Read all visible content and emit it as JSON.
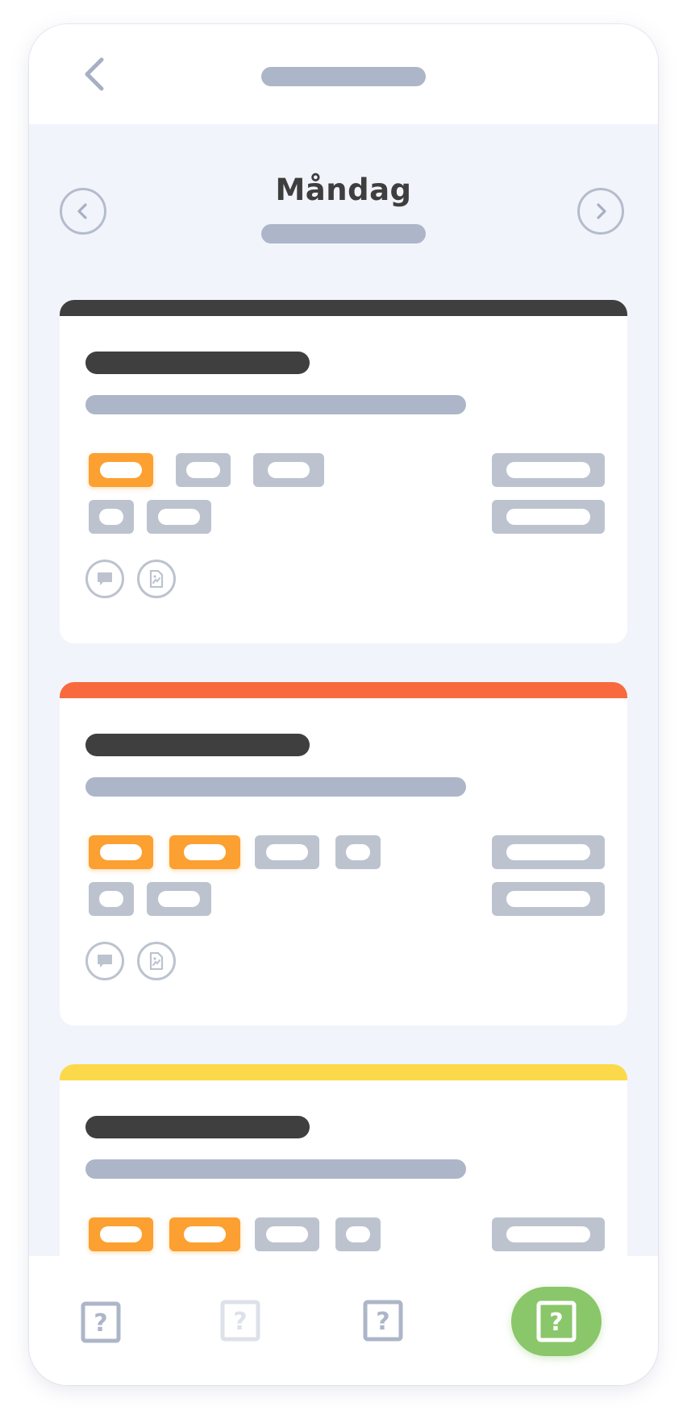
{
  "header": {
    "back_icon": "chevron-left-icon"
  },
  "day_nav": {
    "title": "Måndag",
    "prev_icon": "chevron-left-icon",
    "next_icon": "chevron-right-icon"
  },
  "cards": [
    {
      "accent_color": "#3f3f3f",
      "status": "dark"
    },
    {
      "accent_color": "#f86a3d",
      "status": "orange"
    },
    {
      "accent_color": "#fbd94a",
      "status": "yellow"
    }
  ],
  "card_icons": [
    "comment-icon",
    "document-icon"
  ],
  "bottom_nav": {
    "items": [
      {
        "icon": "question-box-icon",
        "state": "normal"
      },
      {
        "icon": "question-box-icon",
        "state": "disabled"
      },
      {
        "icon": "question-box-icon",
        "state": "normal"
      },
      {
        "icon": "question-box-icon",
        "state": "active"
      }
    ]
  },
  "colors": {
    "background": "#f1f4fa",
    "placeholder": "#adb6c8",
    "tag_active": "#fca031",
    "tag_inactive": "#bcc3cf",
    "nav_active": "#8ac66a",
    "title_text": "#3e3e3e"
  }
}
